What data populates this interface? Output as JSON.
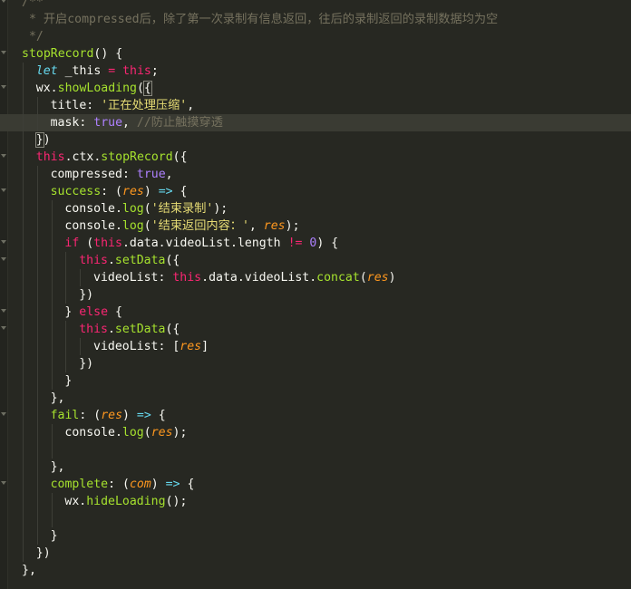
{
  "theme": {
    "background": "#272822",
    "comment": "#75715e",
    "function": "#a6e22e",
    "keyword": "#66d9ef",
    "operator": "#f92672",
    "string": "#e6db74",
    "constant": "#ae81ff",
    "parameter": "#fd971f",
    "text": "#f8f8f2"
  },
  "editor": {
    "highlighted_line": 7,
    "lines": [
      {
        "indent": 0,
        "fold": true,
        "tokens": [
          [
            "comment",
            "/**"
          ]
        ]
      },
      {
        "indent": 0,
        "fold": false,
        "tokens": [
          [
            "comment",
            " * 开启compressed后，除了第一次录制有信息返回，往后的录制返回的录制数据均为空"
          ]
        ]
      },
      {
        "indent": 0,
        "fold": false,
        "tokens": [
          [
            "comment",
            " */"
          ]
        ]
      },
      {
        "indent": 0,
        "fold": true,
        "tokens": [
          [
            "fn",
            "stopRecord"
          ],
          [
            "plain",
            "() {"
          ]
        ]
      },
      {
        "indent": 1,
        "fold": false,
        "tokens": [
          [
            "kw",
            "let"
          ],
          [
            "plain",
            " _this "
          ],
          [
            "op",
            "="
          ],
          [
            "plain",
            " "
          ],
          [
            "kw2",
            "this"
          ],
          [
            "plain",
            ";"
          ]
        ]
      },
      {
        "indent": 1,
        "fold": true,
        "tokens": [
          [
            "plain",
            "wx."
          ],
          [
            "fn",
            "showLoading"
          ],
          [
            "plain",
            "("
          ],
          [
            "brkt",
            "{"
          ]
        ]
      },
      {
        "indent": 2,
        "fold": false,
        "tokens": [
          [
            "prop",
            "title"
          ],
          [
            "plain",
            ": "
          ],
          [
            "str",
            "'正在处理压缩'"
          ],
          [
            "plain",
            ","
          ]
        ]
      },
      {
        "indent": 2,
        "fold": false,
        "tokens": [
          [
            "prop",
            "mask"
          ],
          [
            "plain",
            ": "
          ],
          [
            "bool",
            "true"
          ],
          [
            "plain",
            ", "
          ],
          [
            "comment",
            "//防止触摸穿透"
          ]
        ]
      },
      {
        "indent": 1,
        "fold": false,
        "tokens": [
          [
            "brkt",
            "}"
          ],
          [
            "plain",
            ")"
          ]
        ]
      },
      {
        "indent": 1,
        "fold": true,
        "tokens": [
          [
            "kw2",
            "this"
          ],
          [
            "plain",
            ".ctx."
          ],
          [
            "fn",
            "stopRecord"
          ],
          [
            "plain",
            "({"
          ]
        ]
      },
      {
        "indent": 2,
        "fold": false,
        "tokens": [
          [
            "prop",
            "compressed"
          ],
          [
            "plain",
            ": "
          ],
          [
            "bool",
            "true"
          ],
          [
            "plain",
            ","
          ]
        ]
      },
      {
        "indent": 2,
        "fold": true,
        "tokens": [
          [
            "fn",
            "success"
          ],
          [
            "plain",
            ": ("
          ],
          [
            "param",
            "res"
          ],
          [
            "plain",
            ") "
          ],
          [
            "kw",
            "=>"
          ],
          [
            "plain",
            " {"
          ]
        ]
      },
      {
        "indent": 3,
        "fold": false,
        "tokens": [
          [
            "plain",
            "console."
          ],
          [
            "fn",
            "log"
          ],
          [
            "plain",
            "("
          ],
          [
            "str",
            "'结束录制'"
          ],
          [
            "plain",
            ");"
          ]
        ]
      },
      {
        "indent": 3,
        "fold": false,
        "tokens": [
          [
            "plain",
            "console."
          ],
          [
            "fn",
            "log"
          ],
          [
            "plain",
            "("
          ],
          [
            "str",
            "'结束返回内容：'"
          ],
          [
            "plain",
            ", "
          ],
          [
            "param",
            "res"
          ],
          [
            "plain",
            ");"
          ]
        ]
      },
      {
        "indent": 3,
        "fold": true,
        "tokens": [
          [
            "kw2",
            "if"
          ],
          [
            "plain",
            " ("
          ],
          [
            "kw2",
            "this"
          ],
          [
            "plain",
            ".data.videoList.length "
          ],
          [
            "op",
            "!="
          ],
          [
            "plain",
            " "
          ],
          [
            "num",
            "0"
          ],
          [
            "plain",
            ") {"
          ]
        ]
      },
      {
        "indent": 4,
        "fold": true,
        "tokens": [
          [
            "kw2",
            "this"
          ],
          [
            "plain",
            "."
          ],
          [
            "fn",
            "setData"
          ],
          [
            "plain",
            "({"
          ]
        ]
      },
      {
        "indent": 5,
        "fold": false,
        "tokens": [
          [
            "prop",
            "videoList"
          ],
          [
            "plain",
            ": "
          ],
          [
            "kw2",
            "this"
          ],
          [
            "plain",
            ".data.videoList."
          ],
          [
            "fn",
            "concat"
          ],
          [
            "plain",
            "("
          ],
          [
            "param",
            "res"
          ],
          [
            "plain",
            ")"
          ]
        ]
      },
      {
        "indent": 4,
        "fold": false,
        "tokens": [
          [
            "plain",
            "})"
          ]
        ]
      },
      {
        "indent": 3,
        "fold": true,
        "tokens": [
          [
            "plain",
            "} "
          ],
          [
            "kw2",
            "else"
          ],
          [
            "plain",
            " {"
          ]
        ]
      },
      {
        "indent": 4,
        "fold": true,
        "tokens": [
          [
            "kw2",
            "this"
          ],
          [
            "plain",
            "."
          ],
          [
            "fn",
            "setData"
          ],
          [
            "plain",
            "({"
          ]
        ]
      },
      {
        "indent": 5,
        "fold": false,
        "tokens": [
          [
            "prop",
            "videoList"
          ],
          [
            "plain",
            ": ["
          ],
          [
            "param",
            "res"
          ],
          [
            "plain",
            "]"
          ]
        ]
      },
      {
        "indent": 4,
        "fold": false,
        "tokens": [
          [
            "plain",
            "})"
          ]
        ]
      },
      {
        "indent": 3,
        "fold": false,
        "tokens": [
          [
            "plain",
            "}"
          ]
        ]
      },
      {
        "indent": 2,
        "fold": false,
        "tokens": [
          [
            "plain",
            "},"
          ]
        ]
      },
      {
        "indent": 2,
        "fold": true,
        "tokens": [
          [
            "fn",
            "fail"
          ],
          [
            "plain",
            ": ("
          ],
          [
            "param",
            "res"
          ],
          [
            "plain",
            ") "
          ],
          [
            "kw",
            "=>"
          ],
          [
            "plain",
            " {"
          ]
        ]
      },
      {
        "indent": 3,
        "fold": false,
        "tokens": [
          [
            "plain",
            "console."
          ],
          [
            "fn",
            "log"
          ],
          [
            "plain",
            "("
          ],
          [
            "param",
            "res"
          ],
          [
            "plain",
            ");"
          ]
        ]
      },
      {
        "indent": 3,
        "fold": false,
        "tokens": []
      },
      {
        "indent": 2,
        "fold": false,
        "tokens": [
          [
            "plain",
            "},"
          ]
        ]
      },
      {
        "indent": 2,
        "fold": true,
        "tokens": [
          [
            "fn",
            "complete"
          ],
          [
            "plain",
            ": ("
          ],
          [
            "param",
            "com"
          ],
          [
            "plain",
            ") "
          ],
          [
            "kw",
            "=>"
          ],
          [
            "plain",
            " {"
          ]
        ]
      },
      {
        "indent": 3,
        "fold": false,
        "tokens": [
          [
            "plain",
            "wx."
          ],
          [
            "fn",
            "hideLoading"
          ],
          [
            "plain",
            "();"
          ]
        ]
      },
      {
        "indent": 3,
        "fold": false,
        "tokens": []
      },
      {
        "indent": 2,
        "fold": false,
        "tokens": [
          [
            "plain",
            "}"
          ]
        ]
      },
      {
        "indent": 1,
        "fold": false,
        "tokens": [
          [
            "plain",
            "})"
          ]
        ]
      },
      {
        "indent": 0,
        "fold": false,
        "tokens": [
          [
            "plain",
            "},"
          ]
        ]
      }
    ]
  }
}
